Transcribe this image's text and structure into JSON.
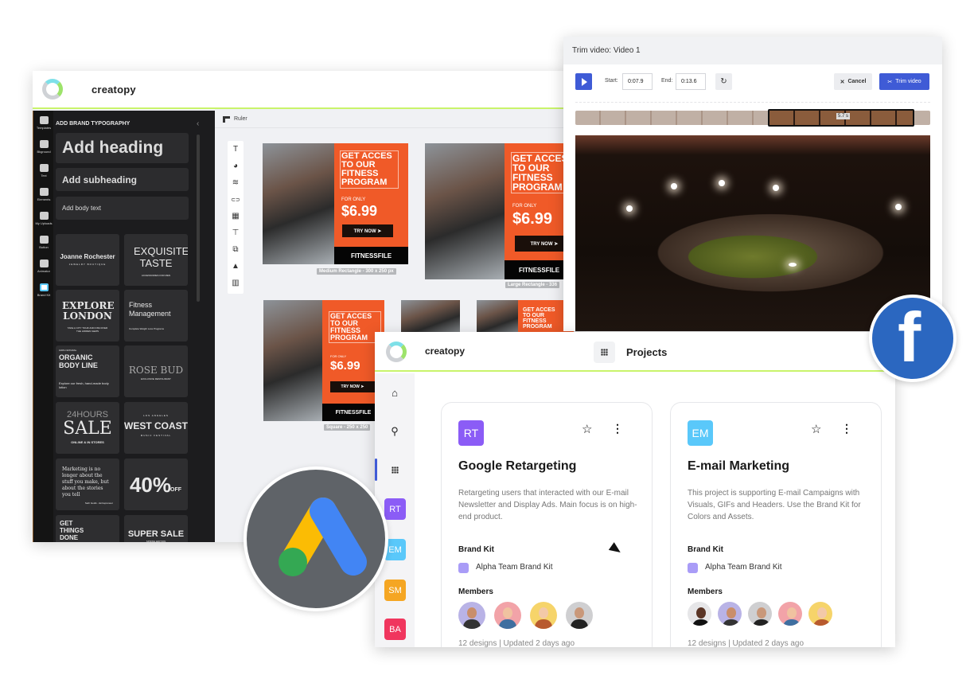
{
  "editor": {
    "brand": "creatopy",
    "rail": [
      {
        "label": "Templates",
        "icon": "templates-icon"
      },
      {
        "label": "Bkground",
        "icon": "background-icon"
      },
      {
        "label": "Text",
        "icon": "text-icon"
      },
      {
        "label": "Elements",
        "icon": "elements-icon"
      },
      {
        "label": "My Uploads",
        "icon": "upload-icon"
      },
      {
        "label": "Button",
        "icon": "button-icon"
      },
      {
        "label": "Animator",
        "icon": "animator-icon"
      },
      {
        "label": "Brand Kit",
        "icon": "brand-kit-icon"
      }
    ],
    "panel_title": "ADD BRAND TYPOGRAPHY",
    "collapse_glyph": "‹",
    "typography": {
      "heading": "Add heading",
      "subheading": "Add subheading",
      "body": "Add body text"
    },
    "text_templates": [
      {
        "main": "Joanne Rochester",
        "sub": "JEWELRY BOUTIQUE"
      },
      {
        "main": "EXQUISITE TASTE",
        "sub": "ACCESSORIES FOR MEN"
      },
      {
        "main": "EXPLORE LONDON",
        "sub": "TAKE A CITY TOUR AND DISCOVER THE HIDDEN GEMS"
      },
      {
        "main": "Fitness Management",
        "sub": "Complete Weight Loss Programs"
      },
      {
        "main": "ORGANIC BODY LINE",
        "sub": "Explore our fresh, hand-made body lotion",
        "kicker": "100% NATURAL"
      },
      {
        "main": "ROSE BUD",
        "sub": "EXCLUSIVE RESTAURANT"
      },
      {
        "main": "SALE",
        "kicker": "24HOURS",
        "sub": "ONLINE & IN STORES"
      },
      {
        "main": "WEST COAST",
        "kicker": "LOS ANGELES",
        "sub": "MUSIC FESTIVAL"
      },
      {
        "main": "Marketing is no longer about the stuff you make, but about the stories you tell",
        "sub": "Seth Godin - Entrepreneur"
      },
      {
        "main": "40%",
        "sub": "OFF"
      },
      {
        "main": "GET THINGS DONE"
      },
      {
        "main": "SUPER SALE",
        "sub": "SPRING EDITION"
      }
    ],
    "ruler_label": "Ruler",
    "tools": [
      {
        "icon": "text-tool-icon",
        "glyph": "T"
      },
      {
        "icon": "palette-icon",
        "glyph": "🎨"
      },
      {
        "icon": "layers-icon",
        "glyph": "≋"
      },
      {
        "icon": "link-icon",
        "glyph": "⊂⊃"
      },
      {
        "icon": "film-icon",
        "glyph": "▦"
      },
      {
        "icon": "paint-roller-icon",
        "glyph": "🖌"
      },
      {
        "icon": "duplicate-icon",
        "glyph": "⧉"
      },
      {
        "icon": "lock-icon",
        "glyph": "🔒"
      },
      {
        "icon": "trash-icon",
        "glyph": "🗑"
      }
    ],
    "ad": {
      "headline": "GET ACCES TO OUR FITNESS PROGRAM",
      "for_only": "FOR ONLY",
      "price": "$6.99",
      "cta": "TRY NOW ➤",
      "brand": "FITNESSFILE"
    },
    "ad_sizes": [
      "Medium Rectangle - 300 x 250 px",
      "Large Rectangle - 336",
      "Square - 250 x 250"
    ]
  },
  "trim": {
    "title": "Trim video: Video 1",
    "start_label": "Start:",
    "start_value": "0:07.9",
    "end_label": "End:",
    "end_value": "0:13.6",
    "cancel": "Cancel",
    "trim_button": "Trim video",
    "duration": "5.7 s",
    "accent": "#3f5bd6"
  },
  "projects": {
    "brand": "creatopy",
    "title": "Projects",
    "side_badges": [
      {
        "text": "RT",
        "color": "#8b5cf6"
      },
      {
        "text": "EM",
        "color": "#5ac8fa"
      },
      {
        "text": "SM",
        "color": "#f5a623"
      },
      {
        "text": "BA",
        "color": "#f0365e"
      }
    ],
    "cards": [
      {
        "badge": "RT",
        "badge_color": "#8b5cf6",
        "title": "Google Retargeting",
        "description": "Retargeting users that interacted with our E-mail Newsletter and Display Ads. Main focus is on high-end product.",
        "brand_kit_label": "Brand Kit",
        "brand_kit": "Alpha Team Brand Kit",
        "members_label": "Members",
        "members": 4,
        "meta": "12 designs  |  Updated 2 days ago"
      },
      {
        "badge": "EM",
        "badge_color": "#5ac8fa",
        "title": "E-mail Marketing",
        "description": "This project is supporting E-mail Campaigns with Visuals, GIFs and Headers. Use the Brand Kit for Colors and Assets.",
        "brand_kit_label": "Brand Kit",
        "brand_kit": "Alpha Team Brand Kit",
        "members_label": "Members",
        "members": 5,
        "meta": "12 designs  |  Updated 2 days ago"
      }
    ]
  },
  "logos": {
    "google_ads": {
      "blue": "#4285f4",
      "yellow": "#fbbc04",
      "green": "#34a853"
    },
    "facebook": {
      "glyph": "f",
      "color": "#2b67c0"
    }
  }
}
